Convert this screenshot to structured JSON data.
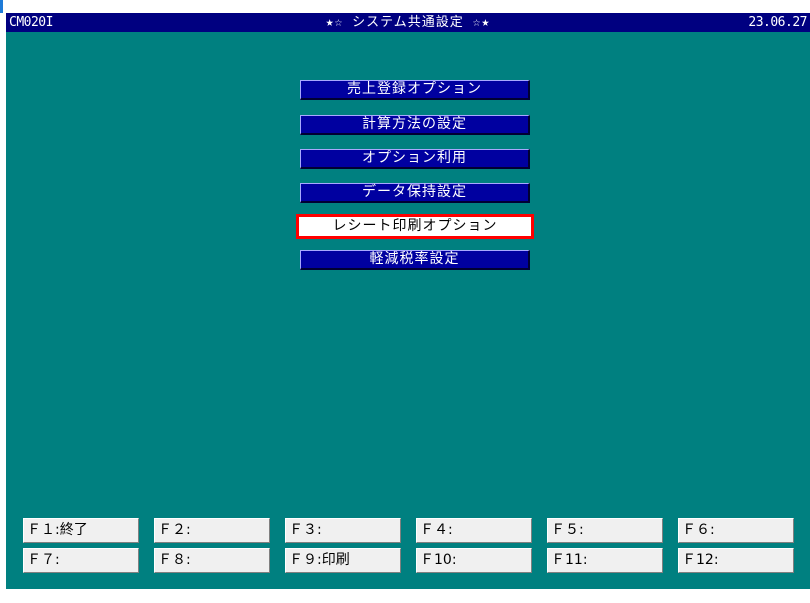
{
  "titlebar": {
    "screen_id": "CM020I",
    "title": "★☆ システム共通設定 ☆★",
    "date": "23.06.27"
  },
  "menu": {
    "items": [
      {
        "label": "売上登録オプション",
        "selected": false
      },
      {
        "label": "計算方法の設定",
        "selected": false
      },
      {
        "label": "オプション利用",
        "selected": false
      },
      {
        "label": "データ保持設定",
        "selected": false
      },
      {
        "label": "レシート印刷オプション",
        "selected": true
      },
      {
        "label": "軽減税率設定",
        "selected": false
      }
    ]
  },
  "function_keys": [
    {
      "label": "Ｆ１:終了"
    },
    {
      "label": "Ｆ２:"
    },
    {
      "label": "Ｆ３:"
    },
    {
      "label": "Ｆ４:"
    },
    {
      "label": "Ｆ５:"
    },
    {
      "label": "Ｆ６:"
    },
    {
      "label": "Ｆ７:"
    },
    {
      "label": "Ｆ８:"
    },
    {
      "label": "Ｆ９:印刷"
    },
    {
      "label": "Ｆ10:"
    },
    {
      "label": "Ｆ11:"
    },
    {
      "label": "Ｆ12:"
    }
  ],
  "colors": {
    "background": "#008080",
    "titlebar": "#000080",
    "menu_button": "#0000a0",
    "selected_border": "#ff0000",
    "function_key": "#f0f0f0"
  }
}
